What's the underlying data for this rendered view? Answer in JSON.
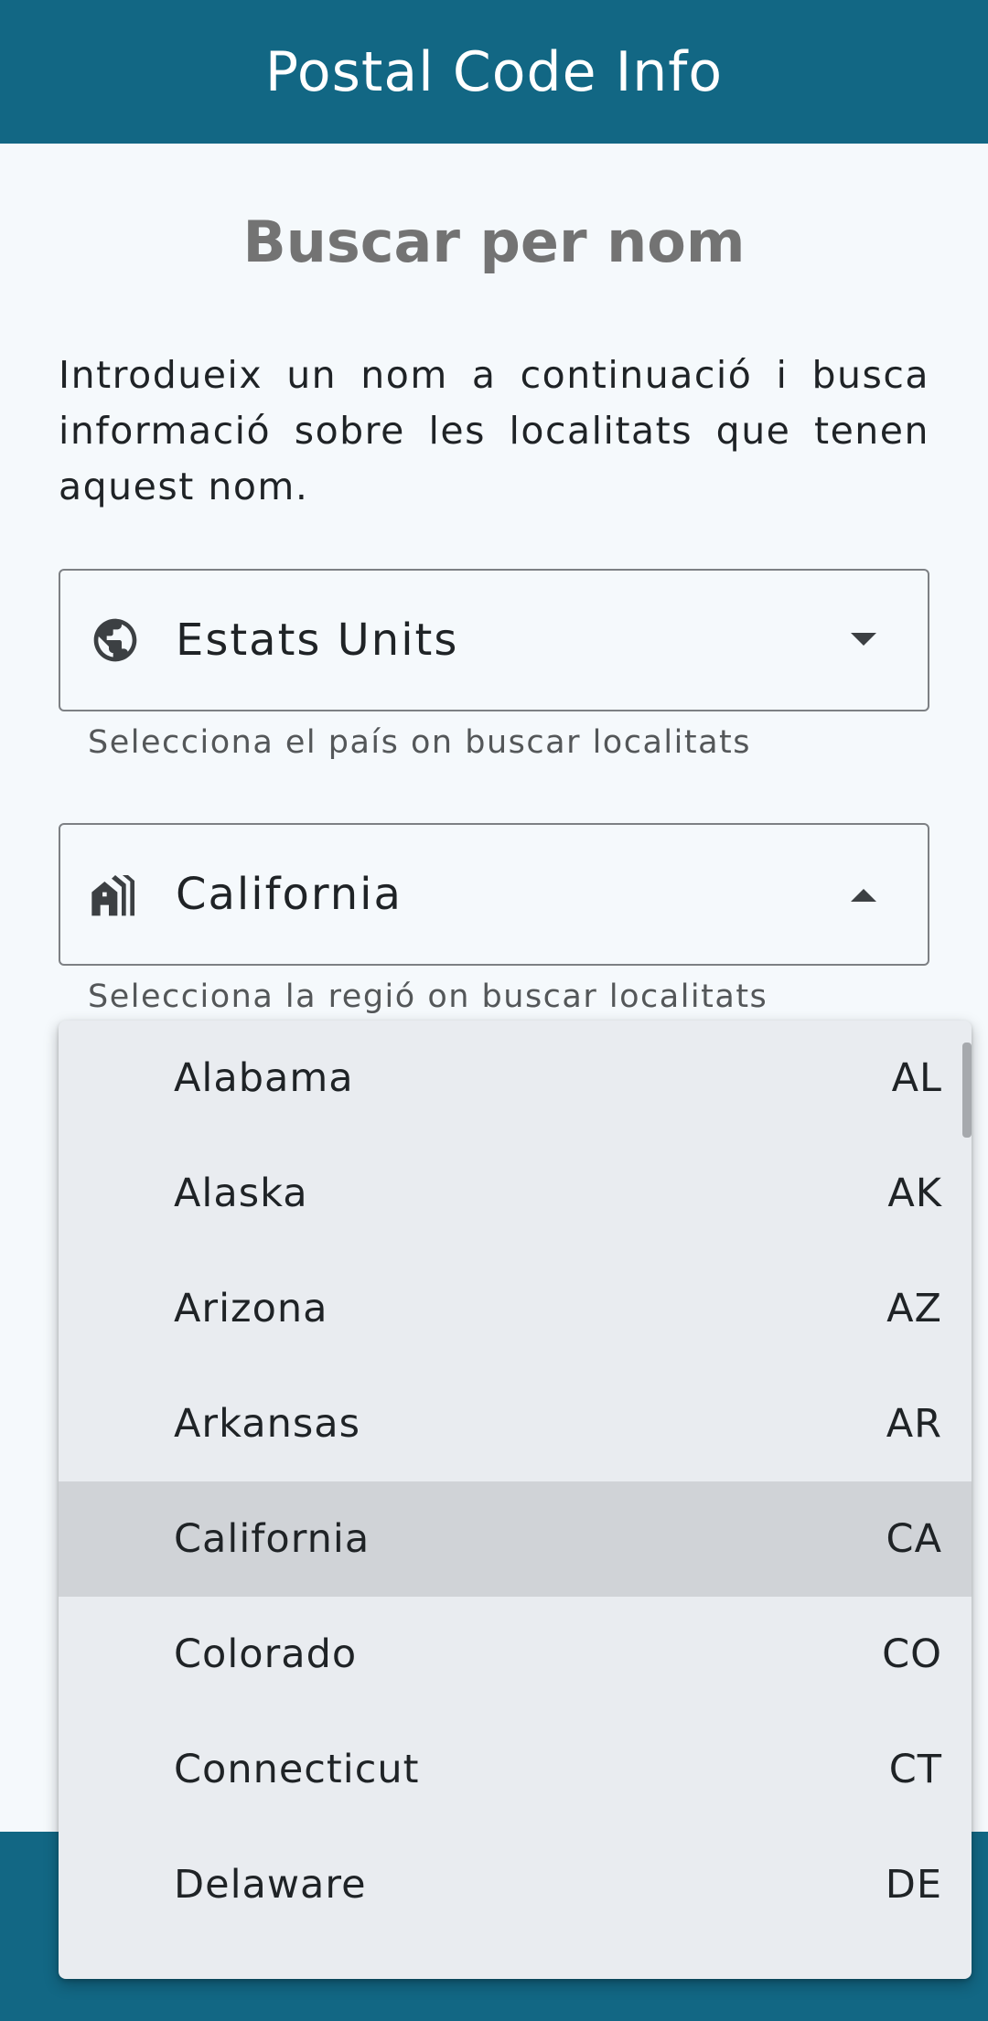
{
  "app": {
    "title": "Postal Code Info"
  },
  "page": {
    "heading": "Buscar per nom",
    "intro": "Introdueix un nom a continuació i busca informació sobre les localitats que tenen aquest nom."
  },
  "country_field": {
    "icon": "globe-icon",
    "value": "Estats Units",
    "helper": "Selecciona el país on buscar localitats",
    "arrow": "dropdown-arrow-down-icon"
  },
  "region_field": {
    "icon": "city-icon",
    "value": "California",
    "helper": "Selecciona la regió on buscar localitats",
    "arrow": "dropdown-arrow-up-icon"
  },
  "region_options": [
    {
      "name": "Alabama",
      "code": "AL"
    },
    {
      "name": "Alaska",
      "code": "AK"
    },
    {
      "name": "Arizona",
      "code": "AZ"
    },
    {
      "name": "Arkansas",
      "code": "AR"
    },
    {
      "name": "California",
      "code": "CA",
      "selected": true
    },
    {
      "name": "Colorado",
      "code": "CO"
    },
    {
      "name": "Connecticut",
      "code": "CT"
    },
    {
      "name": "Delaware",
      "code": "DE"
    }
  ],
  "colors": {
    "primary": "#126784",
    "background": "#f5f9fc",
    "menu_background": "#e9ecf0",
    "selected_option": "#d0d3d7",
    "heading_text": "#737373"
  }
}
